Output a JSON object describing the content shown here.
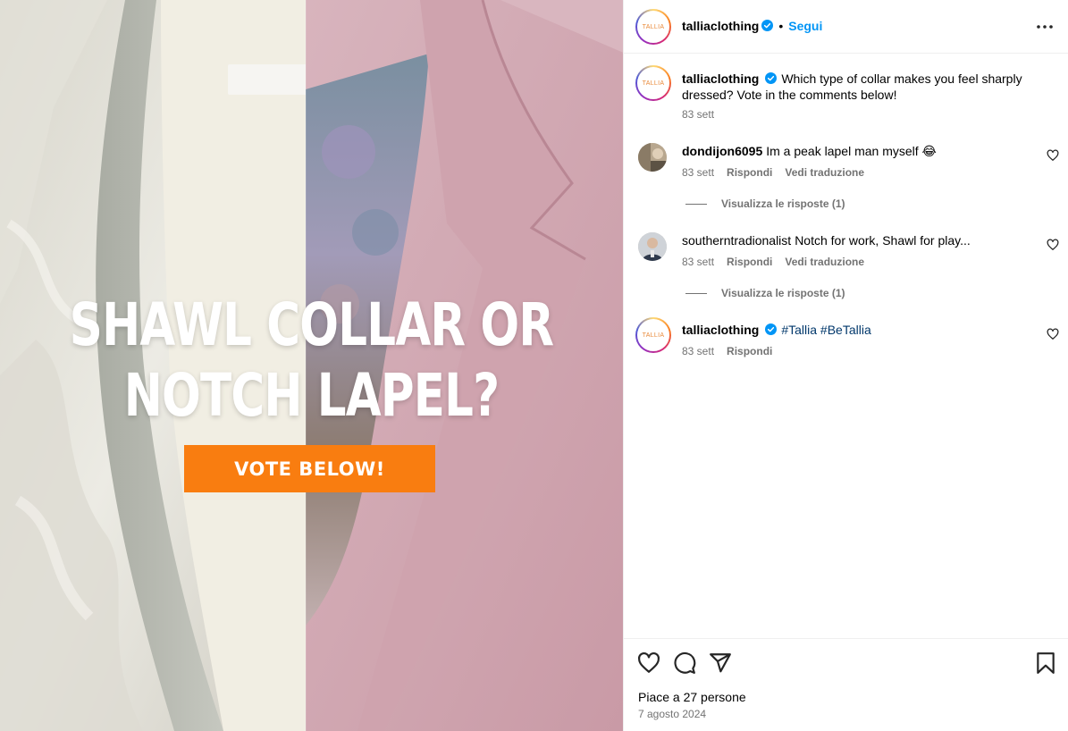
{
  "colors": {
    "accent_blue": "#0095f6",
    "hashtag": "#00376b",
    "muted": "#737373",
    "vote_button": "#f97d10",
    "divider": "#efefef"
  },
  "media": {
    "headline_line1": "SHAWL COLLAR OR",
    "headline_line2": "NOTCH LAPEL?",
    "cta": "VOTE BELOW!"
  },
  "header": {
    "avatar_logo": "TALLIA",
    "username": "talliaclothing",
    "separator": "•",
    "follow_label": "Segui",
    "verified_icon": "verified-badge-icon",
    "more_icon": "more-options-icon"
  },
  "caption": {
    "avatar_logo": "TALLIA",
    "username": "talliaclothing",
    "text": "Which type of collar makes you feel sharply dressed? Vote in the comments below!",
    "time": "83 sett"
  },
  "comments": [
    {
      "username": "dondijon6095",
      "text": "Im a peak lapel man myself 😂",
      "time": "83 sett",
      "reply_label": "Rispondi",
      "translate_label": "Vedi traduzione",
      "view_replies": "Visualizza le risposte (1)"
    },
    {
      "username": "southerntradionalist",
      "text": "Notch for work, Shawl for play...",
      "time": "83 sett",
      "reply_label": "Rispondi",
      "translate_label": "Vedi traduzione",
      "view_replies": "Visualizza le risposte (1)"
    },
    {
      "avatar_logo": "TALLIA",
      "username": "talliaclothing",
      "tags": "#Tallia #BeTallia",
      "time": "83 sett",
      "reply_label": "Rispondi"
    }
  ],
  "footer": {
    "likes": "Piace a 27 persone",
    "date": "7 agosto 2024",
    "icons": [
      "heart-icon",
      "comment-icon",
      "share-icon",
      "bookmark-icon"
    ]
  }
}
